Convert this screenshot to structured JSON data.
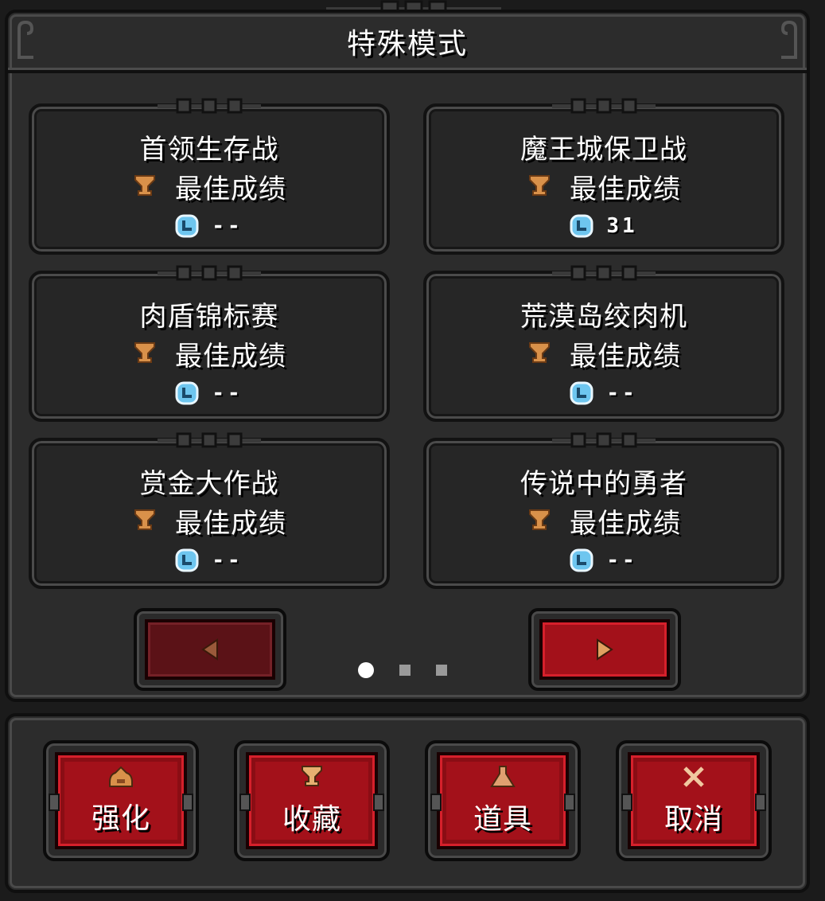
{
  "header": {
    "title": "特殊模式"
  },
  "modes": [
    {
      "name": "首领生存战",
      "best_label": "最佳成绩",
      "score": "--"
    },
    {
      "name": "魔王城保卫战",
      "best_label": "最佳成绩",
      "score": "31"
    },
    {
      "name": "肉盾锦标赛",
      "best_label": "最佳成绩",
      "score": "--"
    },
    {
      "name": "荒漠岛绞肉机",
      "best_label": "最佳成绩",
      "score": "--"
    },
    {
      "name": "赏金大作战",
      "best_label": "最佳成绩",
      "score": "--"
    },
    {
      "name": "传说中的勇者",
      "best_label": "最佳成绩",
      "score": "--"
    }
  ],
  "pagination": {
    "current_page": 1,
    "total_pages": 3
  },
  "actions": [
    {
      "label": "强化",
      "icon": "upgrade-icon"
    },
    {
      "label": "收藏",
      "icon": "trophy-icon"
    },
    {
      "label": "道具",
      "icon": "potion-icon"
    },
    {
      "label": "取消",
      "icon": "close-icon"
    }
  ],
  "colors": {
    "panel": "#2c2c2c",
    "button_red": "#a3111a",
    "button_red_disabled": "#5b1217",
    "trophy": "#d9914a",
    "clock": "#6ec6ef"
  }
}
